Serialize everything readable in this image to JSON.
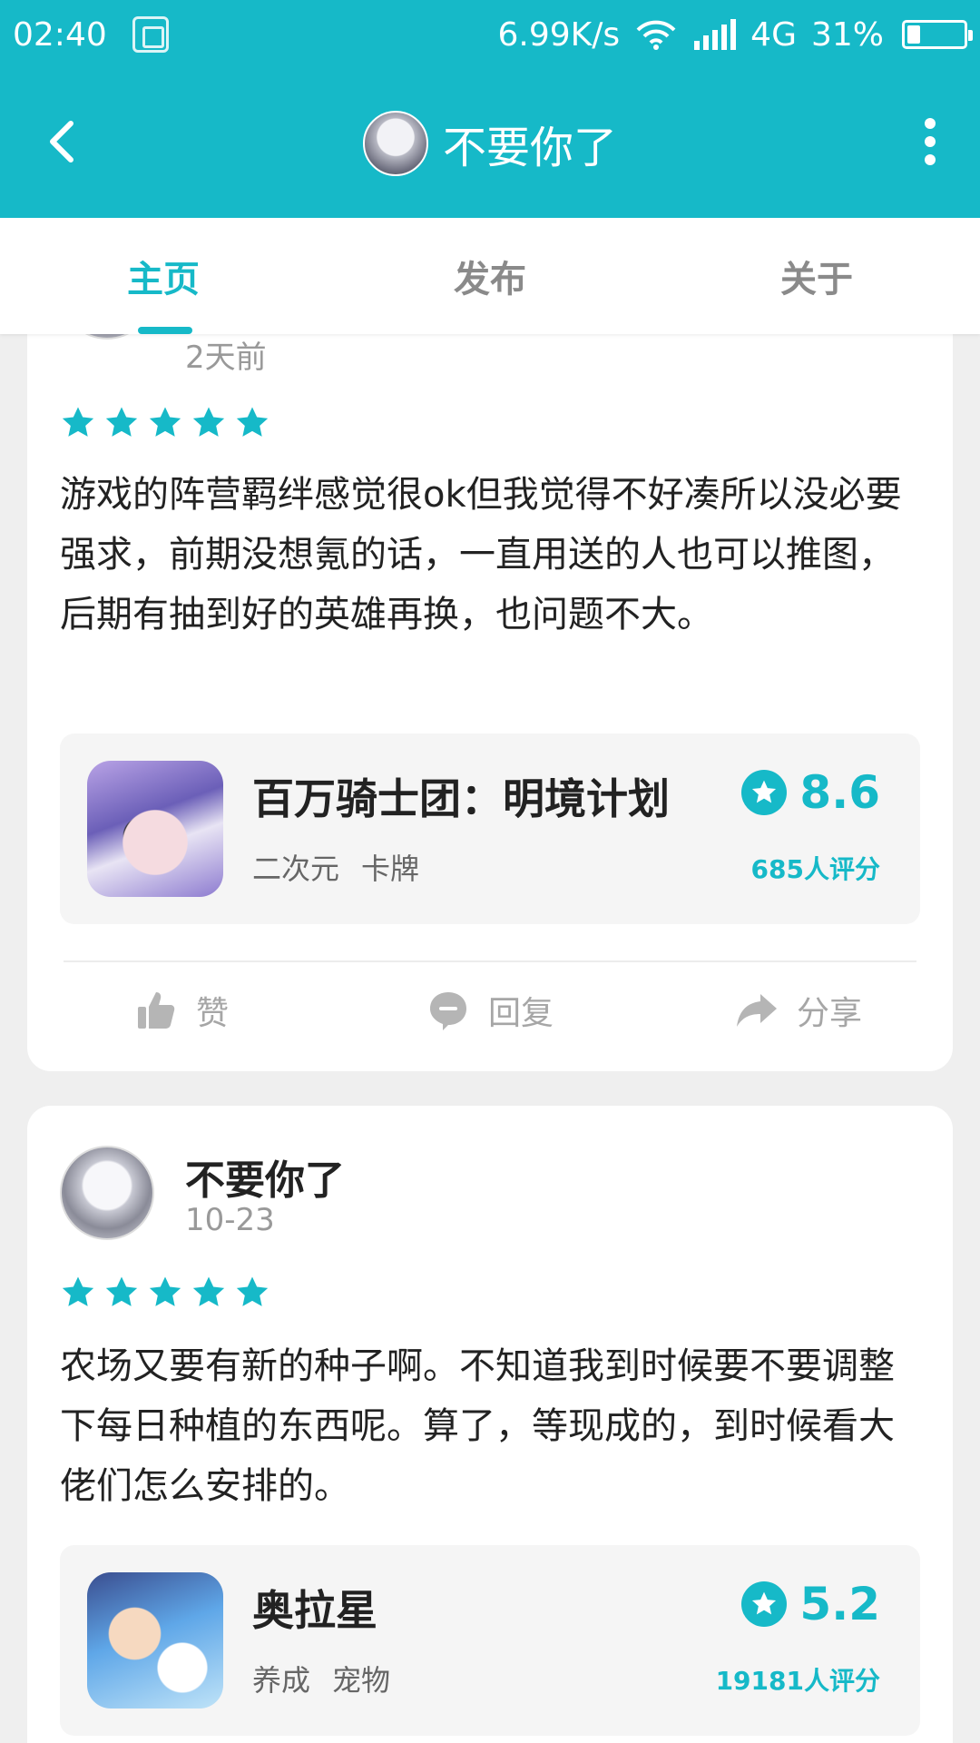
{
  "status_bar": {
    "time": "02:40",
    "speed": "6.99K/s",
    "network": "4G",
    "battery": "31%",
    "battery_level": 0.31
  },
  "nav": {
    "title": "不要你了"
  },
  "tabs": [
    {
      "label": "主页"
    },
    {
      "label": "发布"
    },
    {
      "label": "关于"
    }
  ],
  "posts": [
    {
      "date": "2天前",
      "rating": 5,
      "text": "游戏的阵营羁绊感觉很ok但我觉得不好凑所以没必要强求，前期没想氪的话，一直用送的人也可以推图，后期有抽到好的英雄再换，也问题不大。",
      "game": {
        "name": "百万骑士团：明境计划",
        "tags": [
          "二次元",
          "卡牌"
        ],
        "score": "8.6",
        "raters": "685人评分"
      },
      "actions": {
        "like": "赞",
        "reply": "回复",
        "share": "分享"
      }
    },
    {
      "username": "不要你了",
      "date": "10-23",
      "rating": 5,
      "text": "农场又要有新的种子啊。不知道我到时候要不要调整下每日种植的东西呢。算了，等现成的，到时候看大佬们怎么安排的。",
      "game": {
        "name": "奥拉星",
        "tags": [
          "养成",
          "宠物"
        ],
        "score": "5.2",
        "raters": "19181人评分"
      }
    }
  ],
  "colors": {
    "accent": "#16b9c8",
    "star": "#16b9c8"
  },
  "icons": {
    "back": "chevron-left-icon",
    "more": "more-vertical-icon",
    "like": "thumb-up-icon",
    "reply": "comment-icon",
    "share": "share-icon"
  }
}
